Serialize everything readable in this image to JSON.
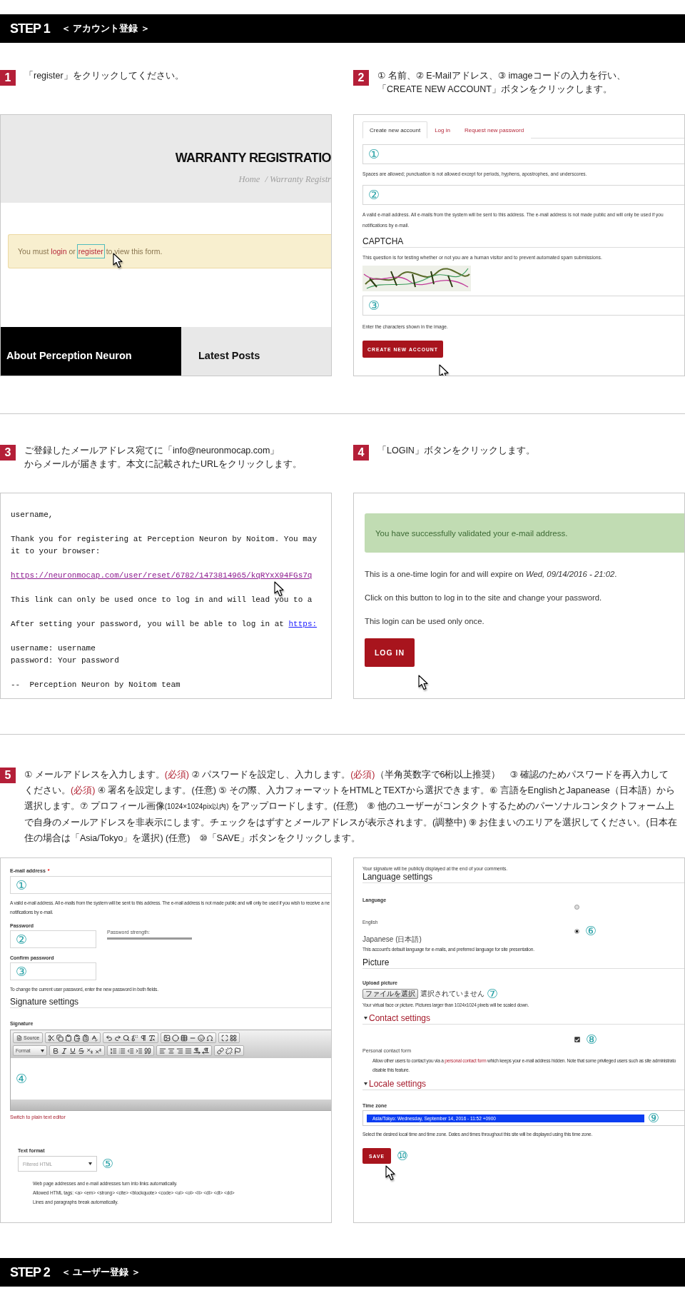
{
  "header": {
    "step": "STEP 1",
    "title": "＜ アカウント登録 ＞"
  },
  "rows": [
    {
      "steps": [
        {
          "number": "1",
          "lines": [
            "「register」をクリックしてください。"
          ]
        },
        {
          "number": "2",
          "lines": [
            "① 名前、② E-Mailアドレス、③ imageコードの入力を行い、",
            "「CREATE NEW ACCOUNT」ボタンをクリックします。"
          ]
        }
      ],
      "panels": [
        {
          "kind": "warranty",
          "title": "WARRANTY REGISTRATIO",
          "breadcrumb": [
            "Home",
            "/ Warranty Registr"
          ],
          "notice": [
            {
              "kind": "text",
              "text": "You must"
            },
            {
              "kind": "link",
              "text": "login"
            },
            {
              "kind": "text",
              "text": "or"
            },
            {
              "kind": "focused-link",
              "text": "register"
            },
            {
              "kind": "text",
              "text": "to view this form."
            }
          ],
          "footer_tabs": [
            {
              "kind": "dark",
              "label": "About Perception Neuron"
            },
            {
              "kind": "light",
              "label": "Latest Posts"
            }
          ]
        },
        {
          "kind": "register",
          "tabs": [
            {
              "label": "Create new account",
              "selected": true
            },
            {
              "label": "Log in",
              "selected": false
            },
            {
              "label": "Request new password",
              "selected": false
            }
          ],
          "fields": [
            {
              "marker": "①",
              "help": [
                "Spaces are allowed; punctuation is not allowed except for periods, hyphens, apostrophes, and underscores."
              ]
            },
            {
              "marker": "②",
              "help": [
                "A valid e-mail address. All e-mails from the system will be sent to this address. The e-mail address is not made public and will only be used if you",
                "notifications by e-mail."
              ]
            }
          ],
          "captcha": {
            "heading": "CAPTCHA",
            "description": "This question is for testing whether or not you are a human visitor and to prevent automated spam submissions.",
            "marker": "③",
            "help": "Enter the characters shown in the image."
          },
          "button": "CREATE NEW ACCOUNT"
        }
      ]
    },
    {
      "steps": [
        {
          "number": "3",
          "lines": [
            "ご登録したメールアドレス宛てに「info@neuronmocap.com」",
            "からメールが届きます。本文に記載されたURLをクリックします。"
          ]
        },
        {
          "number": "4",
          "lines": [
            "「LOGIN」ボタンをクリックします。"
          ]
        }
      ],
      "panels": [
        {
          "kind": "email",
          "paragraphs": [
            [
              {
                "kind": "text",
                "text": "username,"
              }
            ],
            [
              {
                "kind": "text",
                "text": "Thank you for registering at Perception Neuron by Noitom. You may"
              },
              {
                "kind": "text",
                "text": "it to your browser:"
              }
            ],
            [
              {
                "kind": "link",
                "text": "https://neuronmocap.com/user/reset/6782/1473814965/kqRYxX94FGs7q"
              }
            ],
            [
              {
                "kind": "text",
                "text": "This link can only be used once to log in and will lead you to a"
              }
            ],
            [
              {
                "kind": "text",
                "text": "After setting your password, you will be able to log in at",
                "link": "https:"
              }
            ],
            [
              {
                "kind": "text",
                "text": "username: username"
              },
              {
                "kind": "text",
                "text": "password: Your password"
              }
            ],
            [
              {
                "kind": "text",
                "text": "--  Perception Neuron by Noitom team"
              }
            ]
          ]
        },
        {
          "kind": "login",
          "message": "You have successfully validated your e-mail address.",
          "lines": [
            "This is a one-time login for and will expire on *Wed, 09/14/2016 - 21:02*.",
            "Click on this button to log in to the site and change your password.",
            "This login can be used only once."
          ],
          "button": "LOG IN"
        }
      ]
    },
    {
      "steps": [
        {
          "number": "5",
          "segments": [
            {
              "kind": "text",
              "text": "① メールアドレスを入力します。"
            },
            {
              "kind": "required",
              "text": "(必須)"
            },
            {
              "kind": "text",
              "text": " ② パスワードを設定し、入力します。"
            },
            {
              "kind": "required",
              "text": "(必須)"
            },
            {
              "kind": "text",
              "text": "（半角英数字で6桁以上推奨）　③ 確認のためパスワードを再入力してください。"
            },
            {
              "kind": "required",
              "text": "(必須)"
            },
            {
              "kind": "text",
              "text": " ④ 署名を設定します。(任意) ⑤ その際、入力フォーマットをHTMLとTEXTから選択できます。⑥ 言語をEnglishとJapanease（日本語）から選択します。⑦ プロフィール画像"
            },
            {
              "kind": "small",
              "text": "(1024×1024pix以内)"
            },
            {
              "kind": "text",
              "text": " をアップロードします。(任意)　⑧ 他のユーザーがコンタクトするためのパーソナルコンタクトフォーム上で自身のメールアドレスを非表示にします。チェックをはずすとメールアドレスが表示されます。(調整中) ⑨ お住まいのエリアを選択してください。(日本在住の場合は「Asia/Tokyo」を選択) (任意)　⑩「SAVE」ボタンをクリックします。"
            }
          ]
        }
      ],
      "panels": [
        {
          "kind": "account",
          "email": {
            "label": "E-mail address",
            "required": "*",
            "marker": "①",
            "help": [
              "A valid e-mail address. All e-mails from the system will be sent to this address. The e-mail address is not made public and will only be used if you wish to receive a ne",
              "notifications by e-mail."
            ]
          },
          "password": {
            "label": "Password",
            "marker": "②",
            "strength": "Password strength:"
          },
          "confirm": {
            "label": "Confirm password",
            "marker": "③"
          },
          "password_help": "To change the current user password, enter the new password in both fields.",
          "signature": {
            "heading": "Signature settings",
            "label": "Signature",
            "source": "Source",
            "format": "Format",
            "marker": "④",
            "switch_link": "Switch to plain text editor"
          },
          "text_format": {
            "label": "Text format",
            "value": "Filtered HTML",
            "marker": "⑤",
            "tips": [
              "Web page addresses and e-mail addresses turn into links automatically.",
              "Allowed HTML tags: <a> <em> <strong> <cite> <blockquote> <code> <ul> <ol> <li> <dl> <dt> <dd>",
              "Lines and paragraphs break automatically."
            ]
          }
        },
        {
          "kind": "settings",
          "signature_note": "Your signature will be publicly displayed at the end of your comments.",
          "language": {
            "heading": "Language settings",
            "label": "Language",
            "options": [
              {
                "label": "English",
                "selected": false
              },
              {
                "label": "Japanese (日本語)",
                "selected": true,
                "marker": "⑥"
              }
            ],
            "help": "This account's default language for e-mails, and preferred language for site presentation."
          },
          "picture": {
            "heading": "Picture",
            "label": "Upload picture",
            "button": "ファイルを選択",
            "status": "選択されていません",
            "marker": "⑦",
            "help": "Your virtual face or picture. Pictures larger than 1024x1024 pixels will be scaled down."
          },
          "contact": {
            "heading": "Contact settings",
            "expanded": true,
            "checked": true,
            "marker": "⑧",
            "label": "Personal contact form",
            "before": "Allow other users to contact you via a",
            "link": "personal contact form",
            "after": "which keeps your e-mail address hidden. Note that some privileged users such as site administrato",
            "second_line": "disable this feature."
          },
          "locale": {
            "heading": "Locale settings",
            "expanded": true,
            "label": "Time zone",
            "value": "Asia/Tokyo: Wednesday, September 14, 2016 - 11:52 +0900",
            "marker": "⑨",
            "help": "Select the desired local time and time zone. Dates and times throughout this site will be displayed using this time zone."
          },
          "button": "SAVE",
          "button_marker": "⑩"
        }
      ]
    }
  ],
  "footer": {
    "step": "STEP 2",
    "title": "＜ ユーザー登録 ＞"
  }
}
